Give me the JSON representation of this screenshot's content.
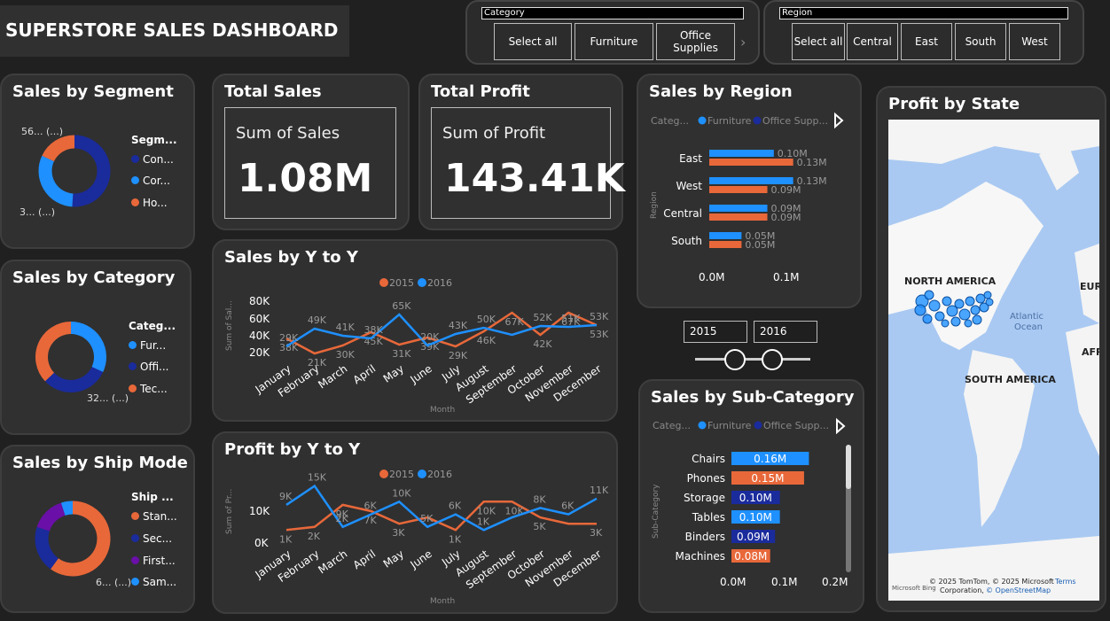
{
  "title": "SUPERSTORE SALES DASHBOARD",
  "colors": {
    "blue": "#1e90ff",
    "orange": "#e8683a",
    "navy": "#1a2b9c",
    "purple": "#6a0fa8",
    "bg": "#202020",
    "card": "#303030"
  },
  "category_slicer": {
    "header": "Category",
    "options": [
      "Select all",
      "Furniture",
      "Office Supplies"
    ],
    "scroll_icon": "chevron-right-icon"
  },
  "region_slicer": {
    "header": "Region",
    "options": [
      "Select all",
      "Central",
      "East",
      "South",
      "West"
    ]
  },
  "segment": {
    "title": "Sales by Segment",
    "legend_title": "Segm...",
    "legend": [
      "Con...",
      "Cor...",
      "Ho..."
    ],
    "label_top": "56... (...)",
    "label_bottom": "3... (...)",
    "shares": [
      0.51,
      0.31,
      0.18
    ]
  },
  "category": {
    "title": "Sales by Category",
    "legend_title": "Categ...",
    "legend": [
      "Fur...",
      "Offi...",
      "Tec..."
    ],
    "label": "32... (...)",
    "shares": [
      0.32,
      0.31,
      0.37
    ]
  },
  "shipmode": {
    "title": "Sales by Ship Mode",
    "legend_title": "Ship ...",
    "legend": [
      "Stan...",
      "Sec...",
      "First...",
      "Sam..."
    ],
    "label": "6... (...)",
    "shares": [
      0.6,
      0.2,
      0.15,
      0.05
    ]
  },
  "total_sales": {
    "title": "Total Sales",
    "label": "Sum of Sales",
    "value": "1.08M"
  },
  "total_profit": {
    "title": "Total Profit",
    "label": "Sum of Profit",
    "value": "143.41K"
  },
  "sales_yoy": {
    "title": "Sales by Y to Y",
    "legend": [
      "2015",
      "2016"
    ],
    "ylabel": "Sum of Sal...",
    "xlabel": "Month",
    "yticks": [
      "80K",
      "60K",
      "40K",
      "20K"
    ]
  },
  "profit_yoy": {
    "title": "Profit by Y to Y",
    "legend": [
      "2015",
      "2016"
    ],
    "ylabel": "Sum of Pr...",
    "xlabel": "Month",
    "yticks": [
      "10K",
      "0K"
    ]
  },
  "region": {
    "title": "Sales by Region",
    "legend_head": "Categ...",
    "legend": [
      "Furniture",
      "Office Supp..."
    ],
    "ylabel": "Region",
    "xticks": [
      "0.0M",
      "0.1M"
    ]
  },
  "years": {
    "from": "2015",
    "to": "2016"
  },
  "subcat": {
    "title": "Sales by Sub-Category",
    "legend_head": "Categ...",
    "legend": [
      "Furniture",
      "Office Supp..."
    ],
    "ylabel": "Sub-Category",
    "xticks": [
      "0.0M",
      "0.1M",
      "0.2M"
    ]
  },
  "map": {
    "title": "Profit by State",
    "labels": [
      "NORTH AMERICA",
      "SOUTH AMERICA",
      "Atlantic",
      "Ocean",
      "EUR",
      "AFR"
    ],
    "attribution": "© 2025 TomTom, © 2025 Microsoft",
    "attribution2": "Corporation,",
    "osm": "© OpenStreetMap",
    "terms": "Terms",
    "ms": "Microsoft Bing"
  },
  "chart_data": [
    {
      "type": "line",
      "title": "Sales by Y to Y",
      "x": [
        "January",
        "February",
        "March",
        "April",
        "May",
        "June",
        "July",
        "August",
        "September",
        "October",
        "November",
        "December"
      ],
      "series": [
        {
          "name": "2015",
          "values": [
            38,
            21,
            30,
            45,
            31,
            39,
            29,
            46,
            67,
            42,
            67,
            53
          ],
          "labels": [
            "38K",
            "21K",
            "30K",
            "45K",
            "31K",
            "39K",
            "29K",
            "46K",
            "67K",
            "42K",
            "67K",
            "53K"
          ]
        },
        {
          "name": "2016",
          "values": [
            29,
            49,
            41,
            38,
            65,
            30,
            43,
            50,
            42,
            52,
            51,
            53
          ],
          "labels": [
            "29K",
            "49K",
            "41K",
            "38K",
            "65K",
            "20K",
            "43K",
            "50K",
            "",
            "52K",
            "51K",
            "53K"
          ]
        }
      ],
      "ylim": [
        20,
        80
      ],
      "xlabel": "Month",
      "ylabel": "Sum of Sal..."
    },
    {
      "type": "line",
      "title": "Profit by Y to Y",
      "x": [
        "January",
        "February",
        "March",
        "April",
        "May",
        "June",
        "July",
        "August",
        "September",
        "October",
        "November",
        "December"
      ],
      "series": [
        {
          "name": "2015",
          "values": [
            1,
            2,
            9,
            7,
            3,
            5,
            1,
            10,
            10,
            5,
            3,
            3
          ],
          "labels": [
            "1K",
            "2K",
            "9K",
            "7K",
            "3K",
            "",
            "1K",
            "10K",
            "10K",
            "5K",
            "",
            "3K"
          ]
        },
        {
          "name": "2016",
          "values": [
            9,
            15,
            2,
            6,
            10,
            2,
            6,
            1,
            5,
            8,
            6,
            11
          ],
          "labels": [
            "9K",
            "15K",
            "2K",
            "6K",
            "10K",
            "5K",
            "6K",
            "1K",
            "",
            "8K",
            "6K",
            "11K"
          ]
        }
      ],
      "ylim": [
        -2,
        16
      ],
      "xlabel": "Month",
      "ylabel": "Sum of Pr..."
    },
    {
      "type": "bar",
      "title": "Sales by Region",
      "categories": [
        "East",
        "West",
        "Central",
        "South"
      ],
      "series": [
        {
          "name": "Furniture",
          "values": [
            0.1,
            0.13,
            0.09,
            0.05
          ],
          "labels": [
            "0.10M",
            "0.13M",
            "0.09M",
            "0.05M"
          ]
        },
        {
          "name": "Office Supp...",
          "values": [
            0.13,
            0.09,
            0.09,
            0.05
          ],
          "labels": [
            "0.13M",
            "0.09M",
            "0.09M",
            "0.05M"
          ]
        }
      ],
      "xlim": [
        0,
        0.15
      ]
    },
    {
      "type": "bar",
      "title": "Sales by Sub-Category",
      "categories": [
        "Chairs",
        "Phones",
        "Storage",
        "Tables",
        "Binders",
        "Machines"
      ],
      "values": [
        0.16,
        0.15,
        0.1,
        0.1,
        0.09,
        0.08
      ],
      "labels": [
        "0.16M",
        "0.15M",
        "0.10M",
        "0.10M",
        "0.09M",
        "0.08M"
      ],
      "colors": [
        "#1e90ff",
        "#e8683a",
        "#1a2b9c",
        "#1e90ff",
        "#1a2b9c",
        "#e8683a"
      ],
      "xlim": [
        0,
        0.2
      ]
    }
  ]
}
